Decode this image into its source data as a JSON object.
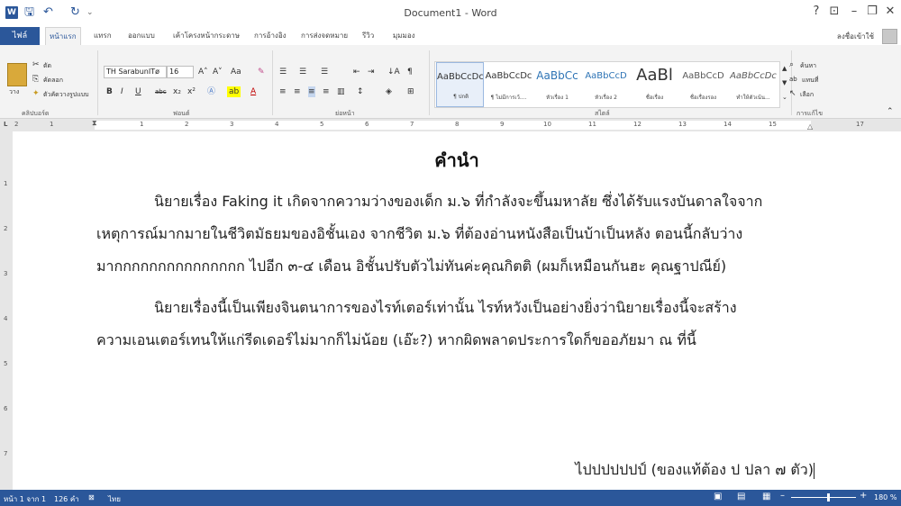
{
  "window": {
    "title": "Document1 - Word",
    "logo_letter": "W",
    "qat": {
      "save": "🖫",
      "undo": "↶",
      "redo": "↻",
      "customize": "⌄"
    },
    "controls": {
      "help": "?",
      "ribbon_display": "⊡",
      "minimize": "–",
      "restore": "❐",
      "close": "✕"
    },
    "sign_in": "ลงชื่อเข้าใช้"
  },
  "tabs": [
    "ไฟล์",
    "หน้าแรก",
    "แทรก",
    "ออกแบบ",
    "เค้าโครงหน้ากระดาษ",
    "การอ้างอิง",
    "การส่งจดหมาย",
    "รีวิว",
    "มุมมอง"
  ],
  "ribbon": {
    "clipboard": {
      "paste": "วาง",
      "cut": "ตัด",
      "copy": "คัดลอก",
      "format_painter": "ตัวคัดวางรูปแบบ",
      "label": "คลิปบอร์ด"
    },
    "font": {
      "name": "TH SarabunITø",
      "size": "16",
      "label": "ฟอนต์",
      "grow": "A˄",
      "shrink": "A˅",
      "case": "Aa",
      "clear": "✎",
      "bold": "B",
      "italic": "I",
      "underline": "U",
      "strike": "abc",
      "subscript": "x₂",
      "superscript": "x²"
    },
    "paragraph": {
      "label": "ย่อหน้า",
      "pilcrow": "¶",
      "sort": "↓A"
    },
    "styles": {
      "label": "สไตล์",
      "items": [
        {
          "sample": "AaBbCcDc",
          "name": "¶ ปกติ"
        },
        {
          "sample": "AaBbCcDc",
          "name": "¶ ไม่มีการเว้...."
        },
        {
          "sample": "AaBbCc",
          "name": "หัวเรื่อง 1"
        },
        {
          "sample": "AaBbCcD",
          "name": "หัวเรื่อง 2"
        },
        {
          "sample": "AaBl",
          "name": "ชื่อเรื่อง"
        },
        {
          "sample": "AaBbCcD",
          "name": "ชื่อเรื่องรอง"
        },
        {
          "sample": "AaBbCcDc",
          "name": "ทำให้ตัวเน้น..."
        }
      ]
    },
    "editing": {
      "label": "การแก้ไข",
      "find": "ค้นหา",
      "replace": "แทนที่",
      "select": "เลือก"
    }
  },
  "ruler": {
    "numbers": [
      "2",
      "1",
      "1",
      "2",
      "3",
      "4",
      "5",
      "6",
      "7",
      "8",
      "9",
      "10",
      "11",
      "12",
      "13",
      "14",
      "15",
      "17"
    ],
    "vnumbers": [
      "1",
      "2",
      "3",
      "4",
      "5",
      "6",
      "7"
    ]
  },
  "document": {
    "heading": "คำนำ",
    "lines": [
      "นิยายเรื่อง Faking it เกิดจากความว่างของเด็ก ม.๖ ที่กำลังจะขึ้นมหาลัย ซึ่งได้รับแรงบันดาลใจจาก",
      "เหตุการณ์มากมายในชีวิตมัธยมของอิชั้นเอง จากชีวิต ม.๖ ที่ต้องอ่านหนังสือเป็นบ้าเป็นหลัง ตอนนี้กลับว่าง",
      "มากกกกกกกกกกกกกกก ไปอีก ๓-๔ เดือน อิชั้นปรับตัวไม่ทันค่ะคุณกิตติ (ผมก็เหมือนกันฮะ คุณฐาปณีย์)",
      "นิยายเรื่องนี้เป็นเพียงจินตนาการของไรท์เตอร์เท่านั้น ไรท์หวังเป็นอย่างยิ่งว่านิยายเรื่องนี้จะสร้าง",
      "ความเอนเตอร์เทนให้แก่รีดเดอร์ไม่มากก็ไม่น้อย (เอ๊ะ?) หากผิดพลาดประการใดก็ขออภัยมา ณ ที่นี้"
    ],
    "signature": "ไปปปปปปป์ (ของแท้ต้อง ป ปลา ๗ ตัว)"
  },
  "status": {
    "page": "หน้า 1 จาก 1",
    "words": "126 คำ",
    "lang": "ไทย",
    "zoom": "180 %"
  }
}
